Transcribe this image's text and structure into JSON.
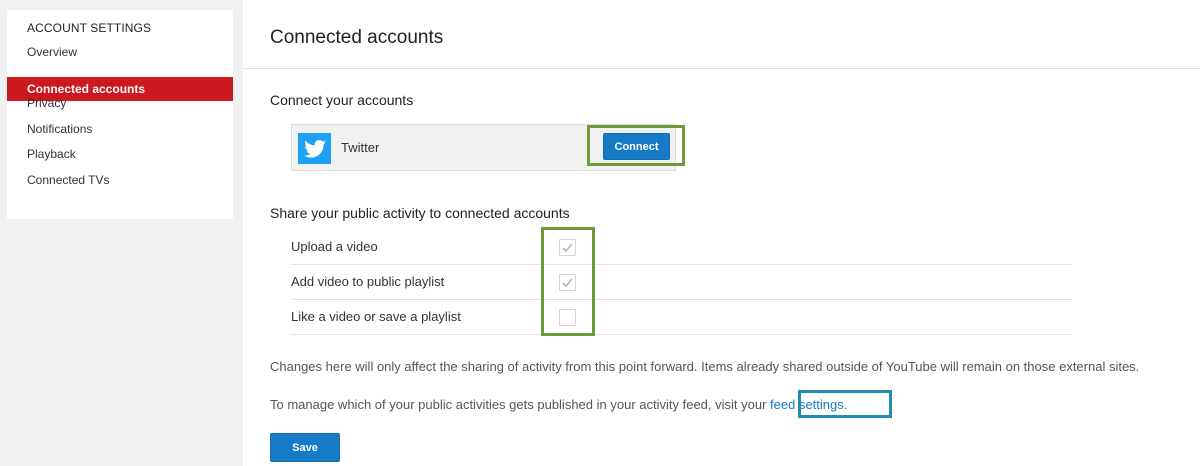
{
  "sidebar": {
    "heading": "ACCOUNT SETTINGS",
    "items": [
      {
        "label": "Overview",
        "active": false
      },
      {
        "label": "Connected accounts",
        "active": true
      },
      {
        "label": "Privacy",
        "active": false
      },
      {
        "label": "Notifications",
        "active": false
      },
      {
        "label": "Playback",
        "active": false
      },
      {
        "label": "Connected TVs",
        "active": false
      }
    ]
  },
  "main": {
    "title": "Connected accounts",
    "connect_section": {
      "heading": "Connect your accounts",
      "account": {
        "name": "Twitter",
        "icon": "twitter-bird-icon"
      },
      "connect_label": "Connect"
    },
    "share_section": {
      "heading": "Share your public activity to connected accounts",
      "options": [
        {
          "label": "Upload a video",
          "checked": true
        },
        {
          "label": "Add video to public playlist",
          "checked": true
        },
        {
          "label": "Like a video or save a playlist",
          "checked": false
        }
      ]
    },
    "notice": "Changes here will only affect the sharing of activity from this point forward. Items already shared outside of YouTube will remain on those external sites.",
    "feed_text": "To manage which of your public activities gets published in your activity feed, visit your ",
    "feed_link": "feed settings.",
    "save_label": "Save"
  },
  "colors": {
    "active_nav": "#cc181e",
    "button_blue": "#167ac6",
    "twitter_blue": "#1da1f2",
    "highlight_green": "#6a9a3c",
    "highlight_blue": "#1e8bb0"
  }
}
